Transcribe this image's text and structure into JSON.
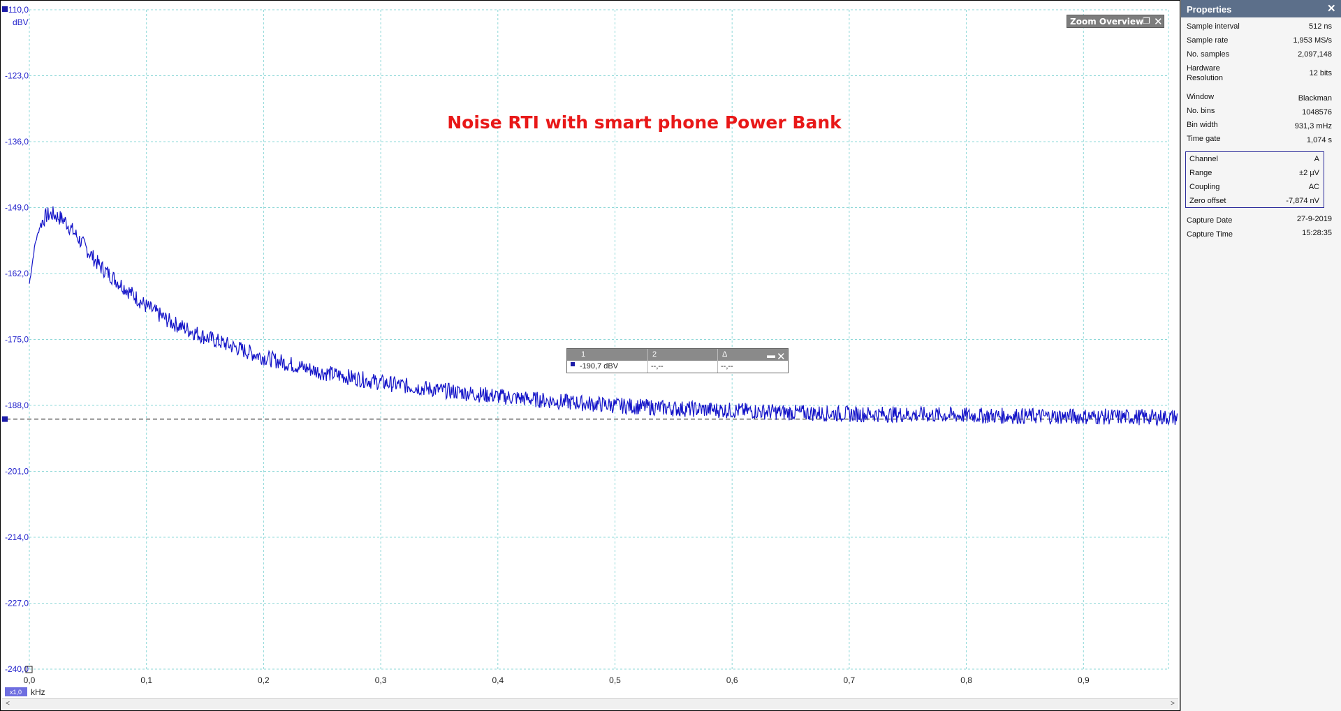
{
  "chart_data": {
    "type": "line",
    "title": "Noise RTI with smart phone Power Bank",
    "y_unit": "dBV",
    "x_unit": "kHz",
    "ylim": [
      -240,
      -110
    ],
    "xlim": [
      0,
      0.98
    ],
    "y_ticks": [
      "-110,0",
      "-123,0",
      "-136,0",
      "-149,0",
      "-162,0",
      "-175,0",
      "-188,0",
      "-201,0",
      "-214,0",
      "-227,0",
      "-240,0"
    ],
    "x_ticks": [
      "0,0",
      "0,1",
      "0,2",
      "0,3",
      "0,4",
      "0,5",
      "0,6",
      "0,7",
      "0,8",
      "0,9"
    ],
    "grid": true,
    "ruler_level": -190.7,
    "series": [
      {
        "color": "#1414c8",
        "x": [
          0.0,
          0.005,
          0.01,
          0.015,
          0.02,
          0.03,
          0.04,
          0.05,
          0.06,
          0.08,
          0.1,
          0.12,
          0.15,
          0.2,
          0.25,
          0.3,
          0.35,
          0.4,
          0.45,
          0.5,
          0.55,
          0.6,
          0.65,
          0.7,
          0.75,
          0.8,
          0.85,
          0.9,
          0.95,
          0.98
        ],
        "values": [
          -164.0,
          -156.0,
          -152.0,
          -150.5,
          -150.3,
          -151.5,
          -154.5,
          -157.5,
          -160.5,
          -164.5,
          -168.5,
          -171.5,
          -174.5,
          -178.5,
          -181.5,
          -183.5,
          -185.0,
          -186.2,
          -187.2,
          -188.0,
          -188.6,
          -189.0,
          -189.4,
          -189.7,
          -189.8,
          -190.0,
          -190.1,
          -190.2,
          -190.3,
          -190.4
        ]
      }
    ]
  },
  "scope": {
    "y_unit_label": "dBV",
    "x_unit_label": "kHz",
    "x_zoom_badge": "x1,0"
  },
  "zoom_overview": {
    "label": "Zoom Overview"
  },
  "ruler_table": {
    "headers": [
      "1",
      "2",
      "Δ"
    ],
    "values": [
      "-190,7 dBV",
      "--,--",
      "--,--"
    ]
  },
  "properties": {
    "title": "Properties",
    "general": [
      {
        "label": "Sample interval",
        "value": "512 ns"
      },
      {
        "label": "Sample rate",
        "value": "1,953 MS/s"
      },
      {
        "label": "No. samples",
        "value": "2,097,148"
      }
    ],
    "hardware_label_1": "Hardware",
    "hardware_label_2": "Resolution",
    "hardware_value": "12 bits",
    "fft": [
      {
        "label": "Window",
        "value": "Blackman"
      },
      {
        "label": "No. bins",
        "value": "1048576"
      },
      {
        "label": "Bin width",
        "value": "931,3 mHz"
      },
      {
        "label": "Time gate",
        "value": "1,074 s"
      }
    ],
    "channel": [
      {
        "label": "Channel",
        "value": "A"
      },
      {
        "label": "Range",
        "value": "±2 µV"
      },
      {
        "label": "Coupling",
        "value": "AC"
      },
      {
        "label": "Zero offset",
        "value": "-7,874 nV"
      }
    ],
    "capture": [
      {
        "label": "Capture Date",
        "value": "27-9-2019"
      },
      {
        "label": "Capture Time",
        "value": "15:28:35"
      }
    ]
  }
}
